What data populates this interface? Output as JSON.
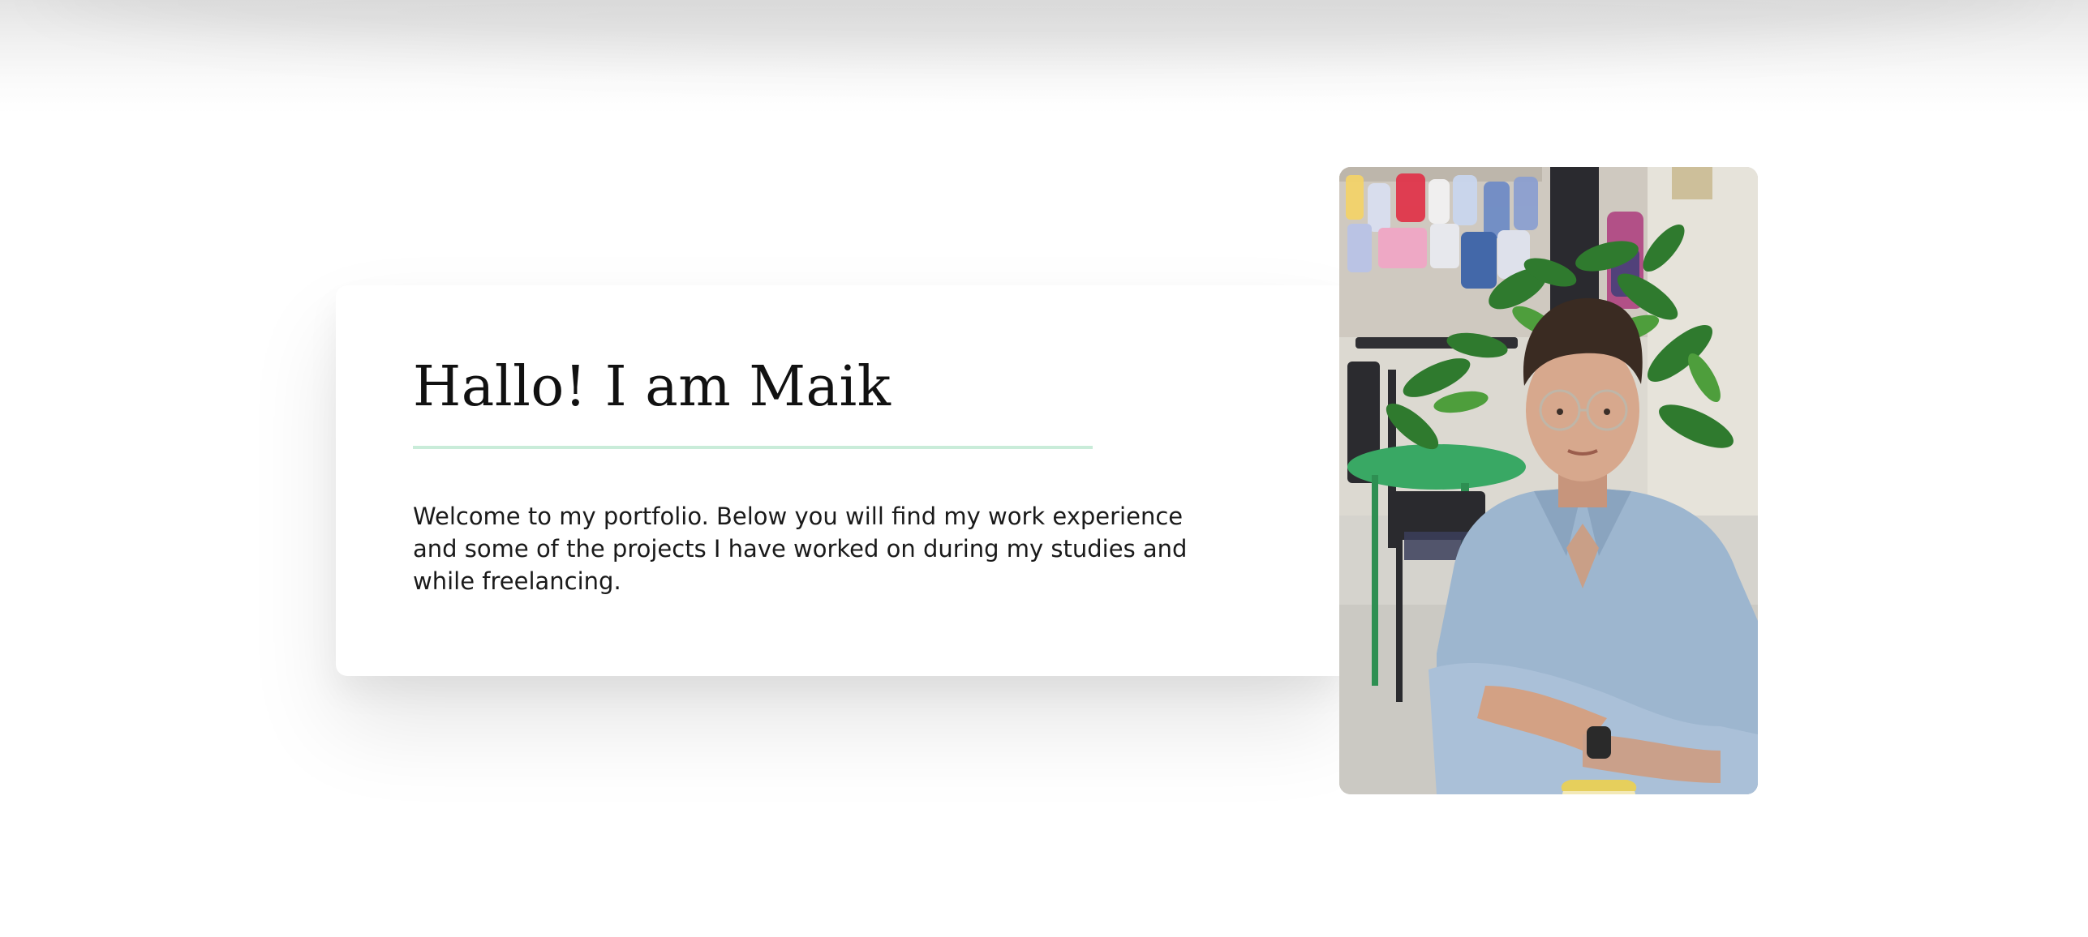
{
  "hero": {
    "title": "Hallo! I am Maik",
    "intro": "Welcome to my portfolio. Below you will find my work experience and some of the projects I have worked on during my studies and while freelancing."
  },
  "colors": {
    "accent_underline": "#c9ecd9",
    "text": "#1a1a1a",
    "background": "#ffffff"
  }
}
